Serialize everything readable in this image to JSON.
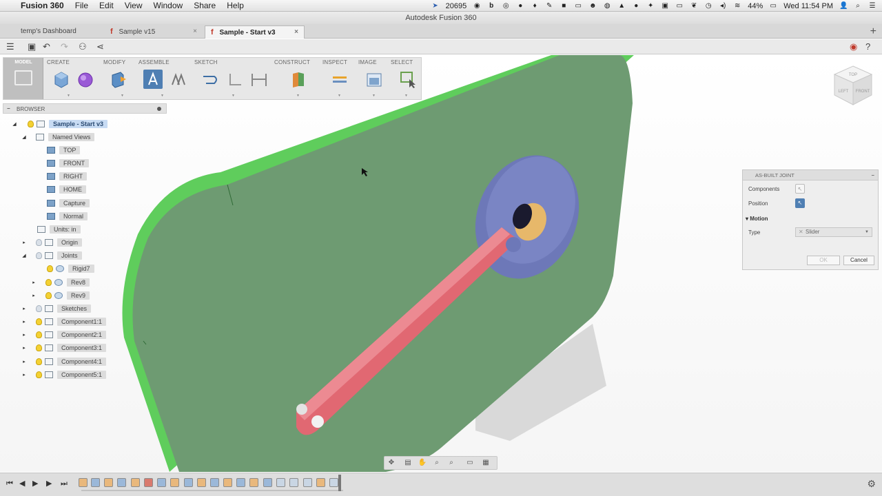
{
  "menubar": {
    "app_name": "Fusion 360",
    "items": [
      "File",
      "Edit",
      "View",
      "Window",
      "Share",
      "Help"
    ],
    "status_count": "20695",
    "battery": "44%",
    "clock": "Wed 11:54 PM"
  },
  "window": {
    "title": "Autodesk Fusion 360"
  },
  "tabs": [
    {
      "label": "temp's Dashboard"
    },
    {
      "label": "Sample v15"
    },
    {
      "label": "Sample - Start v3"
    }
  ],
  "ribbon": {
    "workspace": "MODEL",
    "groups": [
      "CREATE",
      "MODIFY",
      "ASSEMBLE",
      "SKETCH",
      "CONSTRUCT",
      "INSPECT",
      "IMAGE",
      "SELECT"
    ]
  },
  "browser": {
    "title": "BROWSER",
    "root": "Sample - Start v3",
    "named_views": "Named Views",
    "views": [
      "TOP",
      "FRONT",
      "RIGHT",
      "HOME",
      "Capture",
      "Normal"
    ],
    "units": "Units: in",
    "origin": "Origin",
    "joints": "Joints",
    "joint_items": [
      "Rigid7",
      "Rev8",
      "Rev9"
    ],
    "sketches": "Sketches",
    "components": [
      "Component1:1",
      "Component2:1",
      "Component3:1",
      "Component4:1",
      "Component5:1"
    ]
  },
  "dialog": {
    "title": "AS-BUILT JOINT",
    "components_label": "Components",
    "position_label": "Position",
    "motion_section": "Motion",
    "type_label": "Type",
    "type_value": "Slider",
    "ok": "OK",
    "cancel": "Cancel"
  },
  "viewcube": {
    "faces": [
      "TOP",
      "FRONT",
      "LEFT"
    ]
  },
  "colors": {
    "plate": "#6e9b72",
    "plate_edge": "#5fcd5c",
    "disc": "#6d78b8",
    "arm": "#e16872",
    "hub": "#e7b86a",
    "selection": "#c7dbf3"
  }
}
